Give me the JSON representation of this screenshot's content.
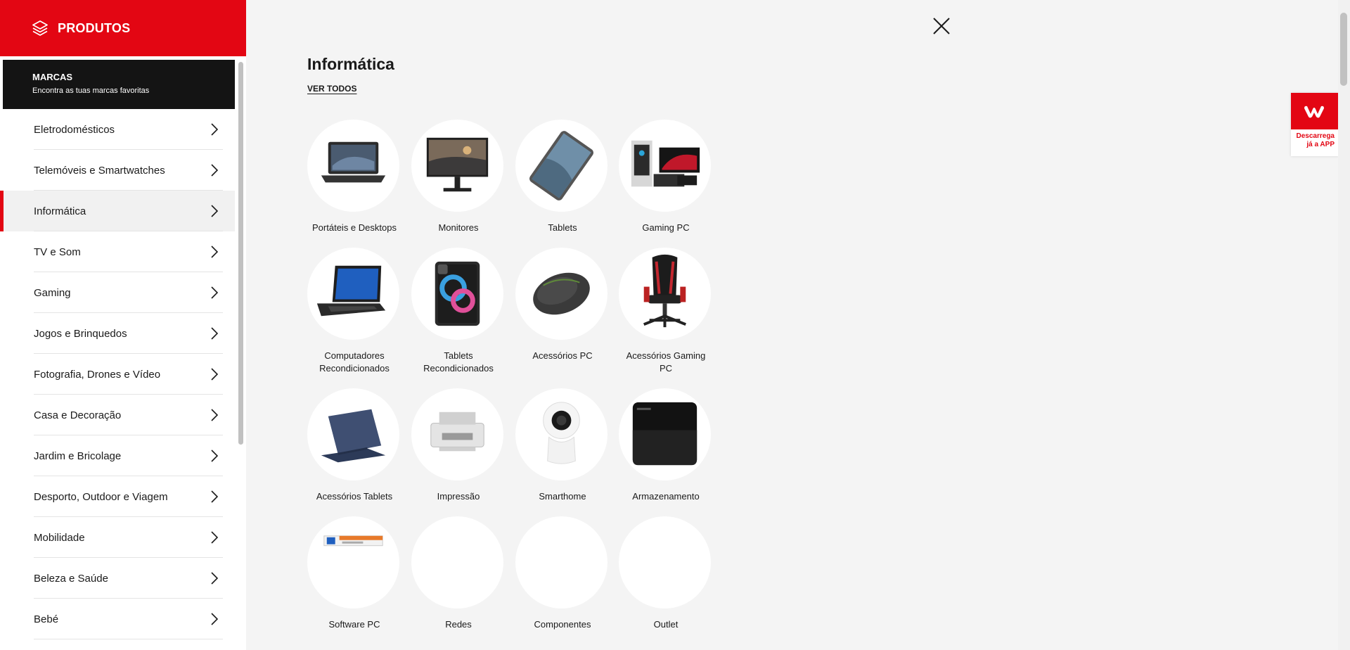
{
  "sidebar": {
    "title": "PRODUTOS",
    "brands": {
      "title": "MARCAS",
      "subtitle": "Encontra as tuas marcas favoritas"
    },
    "items": [
      {
        "label": "Eletrodomésticos"
      },
      {
        "label": "Telemóveis e Smartwatches"
      },
      {
        "label": "Informática",
        "active": true
      },
      {
        "label": "TV e Som"
      },
      {
        "label": "Gaming"
      },
      {
        "label": "Jogos e Brinquedos"
      },
      {
        "label": "Fotografia, Drones e Vídeo"
      },
      {
        "label": "Casa e Decoração"
      },
      {
        "label": "Jardim e Bricolage"
      },
      {
        "label": "Desporto, Outdoor e Viagem"
      },
      {
        "label": "Mobilidade"
      },
      {
        "label": "Beleza e Saúde"
      },
      {
        "label": "Bebé"
      }
    ]
  },
  "main": {
    "title": "Informática",
    "see_all": "VER TODOS",
    "categories": [
      {
        "label": "Portáteis e Desktops",
        "icon": "laptop-icon"
      },
      {
        "label": "Monitores",
        "icon": "monitor-icon"
      },
      {
        "label": "Tablets",
        "icon": "tablet-icon"
      },
      {
        "label": "Gaming PC",
        "icon": "gaming-pc-icon"
      },
      {
        "label": "Computadores Recondicionados",
        "icon": "refurbished-laptop-icon"
      },
      {
        "label": "Tablets Recondicionados",
        "icon": "refurbished-tablet-icon"
      },
      {
        "label": "Acessórios PC",
        "icon": "mouse-icon"
      },
      {
        "label": "Acessórios Gaming PC",
        "icon": "gaming-chair-icon"
      },
      {
        "label": "Acessórios Tablets",
        "icon": "tablet-case-icon"
      },
      {
        "label": "Impressão",
        "icon": "printer-icon"
      },
      {
        "label": "Smarthome",
        "icon": "smart-camera-icon"
      },
      {
        "label": "Armazenamento",
        "icon": "hard-drive-icon"
      },
      {
        "label": "Software PC",
        "icon": "software-icon"
      },
      {
        "label": "Redes",
        "icon": ""
      },
      {
        "label": "Componentes",
        "icon": ""
      },
      {
        "label": "Outlet",
        "icon": ""
      }
    ]
  },
  "app_promo": {
    "line1": "Descarrega",
    "line2": "já a APP"
  },
  "colors": {
    "brand_red": "#e30613",
    "brands_bg": "#141414",
    "content_bg": "#f4f4f4"
  }
}
